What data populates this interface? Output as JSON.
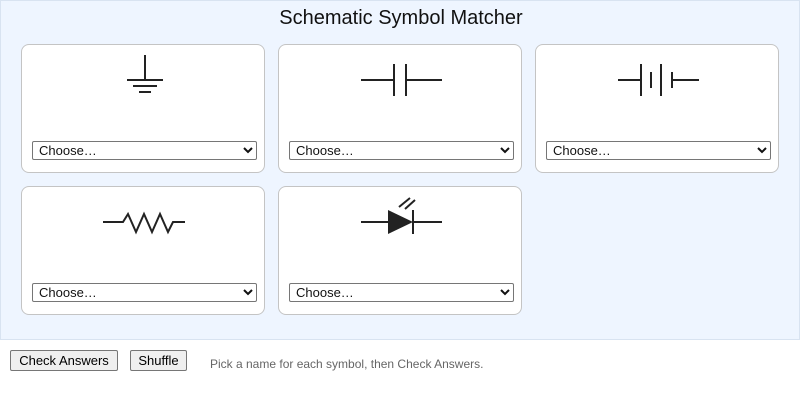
{
  "title": "Schematic Symbol Matcher",
  "cards": [
    {
      "symbol": "ground-symbol-icon",
      "selected": "Choose…"
    },
    {
      "symbol": "capacitor-symbol-icon",
      "selected": "Choose…"
    },
    {
      "symbol": "battery-symbol-icon",
      "selected": "Choose…"
    },
    {
      "symbol": "resistor-symbol-icon",
      "selected": "Choose…"
    },
    {
      "symbol": "led-symbol-icon",
      "selected": "Choose…"
    }
  ],
  "buttons": {
    "check": "Check Answers",
    "shuffle": "Shuffle"
  },
  "hint": "Pick a name for each symbol, then Check Answers."
}
